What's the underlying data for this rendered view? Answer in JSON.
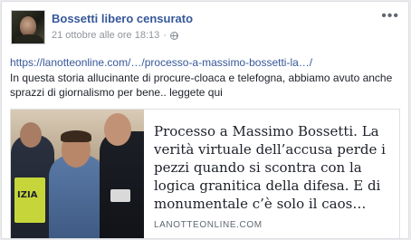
{
  "post": {
    "author": "Bossetti libero censurato",
    "timestamp": "21 ottobre alle ore 18:13",
    "separator": "·",
    "privacy_icon": "globe-icon",
    "more_icon": "more-options-icon",
    "more_label": "•••",
    "link_url": "https://lanotteonline.com/…/processo-a-massimo-bossetti-la…/",
    "text": "In questa storia allucinante di procure-cloaca e telefogna, abbiamo avuto anche sprazzi di giornalismo per bene.. leggete qui"
  },
  "link_card": {
    "title": "Processo a Massimo Bossetti. La verità virtuale dell’accusa perde i pezzi quando si scontra con la logica granitica della difesa. E di monumentale c’è solo il caos…",
    "domain": "LANOTTEONLINE.COM",
    "vest_text": "IZIA"
  },
  "colors": {
    "link": "#365899",
    "meta": "#90949c",
    "text": "#1d2129",
    "background": "#e9ebee"
  }
}
